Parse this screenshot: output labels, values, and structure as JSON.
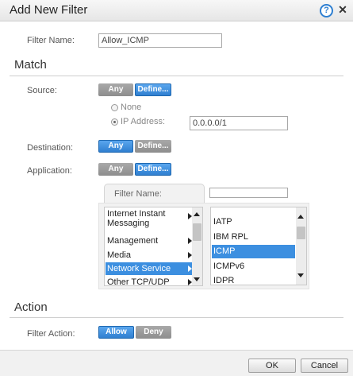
{
  "dialog": {
    "title": "Add New Filter",
    "help_glyph": "?",
    "close_glyph": "✕"
  },
  "filter_name": {
    "label": "Filter Name:",
    "value": "Allow_ICMP"
  },
  "match": {
    "heading": "Match",
    "source": {
      "label": "Source:",
      "any": "Any",
      "define": "Define...",
      "selected": "Define...",
      "none_option": "None",
      "ip_option": "IP Address:",
      "ip_value": "0.0.0.0/1",
      "checked_option": "IP Address:"
    },
    "destination": {
      "label": "Destination:",
      "any": "Any",
      "define": "Define...",
      "selected": "Any"
    },
    "application": {
      "label": "Application:",
      "any": "Any",
      "define": "Define...",
      "selected": "Define...",
      "filter_tab_label": "Filter Name:",
      "filter_value": "",
      "categories": [
        {
          "label": "Internet Instant",
          "label2": "Messaging",
          "selected": false
        },
        {
          "label": "Management",
          "selected": false
        },
        {
          "label": "Media",
          "selected": false
        },
        {
          "label": "Network Service",
          "selected": true
        },
        {
          "label": "Other TCP/UDP",
          "selected": false
        }
      ],
      "apps": [
        {
          "label": "IATP",
          "selected": false
        },
        {
          "label": "IBM RPL",
          "selected": false
        },
        {
          "label": "ICMP",
          "selected": true
        },
        {
          "label": "ICMPv6",
          "selected": false
        },
        {
          "label": "IDPR",
          "selected": false
        }
      ]
    }
  },
  "action": {
    "heading": "Action",
    "label": "Filter Action:",
    "allow": "Allow",
    "deny": "Deny",
    "selected": "Allow"
  },
  "footer": {
    "ok": "OK",
    "cancel": "Cancel"
  },
  "colors": {
    "accent": "#3c8fe0",
    "segment_inactive": "#999999"
  }
}
